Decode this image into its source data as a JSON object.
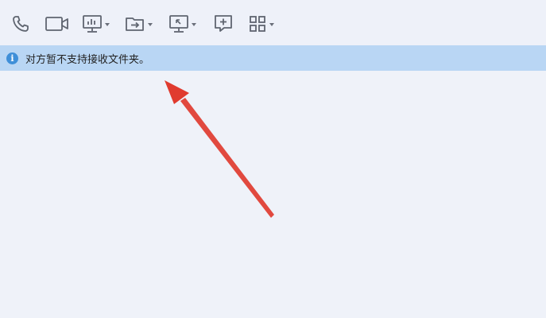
{
  "toolbar": {
    "tools": [
      {
        "name": "voice-call",
        "icon": "phone-icon",
        "has_dropdown": false
      },
      {
        "name": "video-call",
        "icon": "video-camera-icon",
        "has_dropdown": false
      },
      {
        "name": "presentation",
        "icon": "presentation-icon",
        "has_dropdown": true
      },
      {
        "name": "send-file",
        "icon": "folder-arrow-icon",
        "has_dropdown": true
      },
      {
        "name": "screen-share",
        "icon": "monitor-icon",
        "has_dropdown": true
      },
      {
        "name": "add-chat",
        "icon": "chat-plus-icon",
        "has_dropdown": false
      },
      {
        "name": "apps",
        "icon": "grid-icon",
        "has_dropdown": true
      }
    ],
    "icon_color": "#5f6570"
  },
  "notice": {
    "icon": "info-icon",
    "icon_glyph": "i",
    "text": "对方暂不支持接收文件夹。",
    "background": "#b9d6f4"
  },
  "annotation": {
    "arrow_color": "#e03b2f"
  }
}
